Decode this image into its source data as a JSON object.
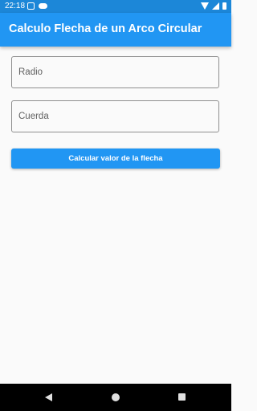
{
  "status_bar": {
    "time": "22:18",
    "left_icons": [
      "notification-icon",
      "cloud-icon"
    ],
    "right_icons": [
      "wifi-icon",
      "signal-icon",
      "battery-icon"
    ]
  },
  "app_bar": {
    "title": "Calculo Flecha de un Arco Circular",
    "color": "#2196f3"
  },
  "form": {
    "radio": {
      "value": "",
      "placeholder": "Radio"
    },
    "cuerda": {
      "value": "",
      "placeholder": "Cuerda"
    },
    "submit_label": "Calcular valor de la flecha"
  },
  "nav_bar": {
    "buttons": [
      "back-icon",
      "home-icon",
      "recent-apps-icon"
    ]
  }
}
